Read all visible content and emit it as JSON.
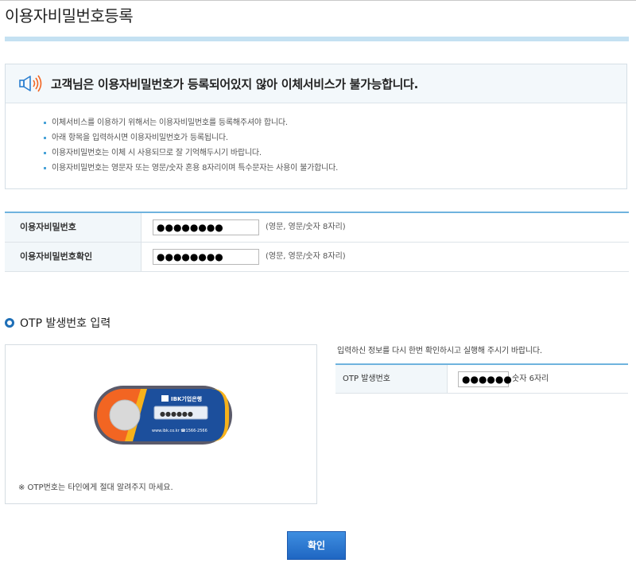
{
  "page": {
    "title": "이용자비밀번호등록"
  },
  "notice": {
    "icon": "speaker-icon",
    "title": "고객님은 이용자비밀번호가 등록되어있지 않아 이체서비스가 불가능합니다.",
    "items": [
      "이체서비스를 이용하기 위해서는 이용자비밀번호를 등록해주셔야 합니다.",
      "아래 항목을 입력하시면 이용자비밀번호가 등록됩니다.",
      "이용자비밀번호는 이체 시 사용되므로 잘 기억해두시기 바랍니다.",
      "이용자비밀번호는 영문자 또는 영문/숫자 혼용 8자리이며 특수문자는 사용이 불가합니다."
    ]
  },
  "form": {
    "rows": [
      {
        "label": "이용자비밀번호",
        "value": "●●●●●●●●",
        "hint": "(영문, 영문/숫자 8자리)"
      },
      {
        "label": "이용자비밀번호확인",
        "value": "●●●●●●●●",
        "hint": "(영문, 영문/숫자 8자리)"
      }
    ]
  },
  "otp": {
    "heading": "OTP 발생번호 입력",
    "token": {
      "brand": "IBK기업은행",
      "display": "●●●●●●",
      "footer": "www.ibk.co.kr ☎1566-2566"
    },
    "note": "※ OTP번호는 타인에게 절대 알려주지 마세요.",
    "confirm_message": "입력하신 정보를 다시 한번 확인하시고 실행해 주시기 바랍니다.",
    "field": {
      "label": "OTP 발생번호",
      "value": "●●●●●●",
      "hint": "숫자 6자리"
    }
  },
  "actions": {
    "confirm_label": "확인"
  },
  "colors": {
    "accent": "#6fb3de",
    "button": "#1f66c2",
    "token_orange": "#f26522",
    "token_yellow": "#f7b21b",
    "token_blue": "#1c4f9c"
  }
}
